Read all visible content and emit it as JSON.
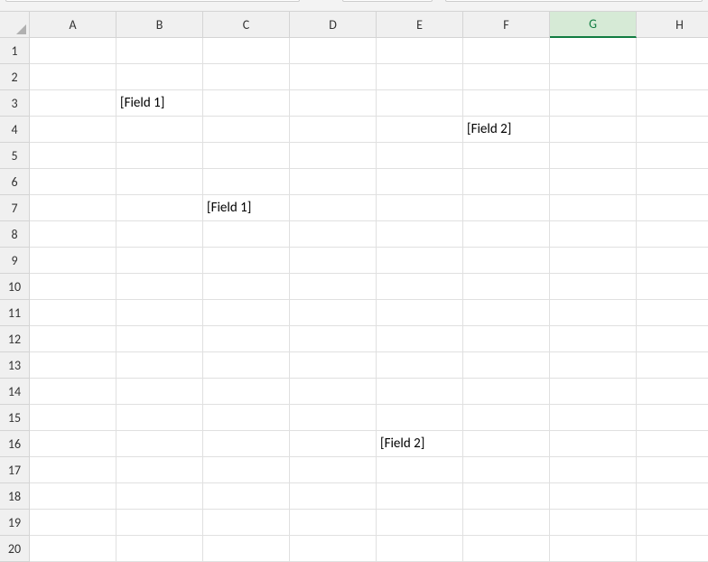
{
  "columns": [
    "A",
    "B",
    "C",
    "D",
    "E",
    "F",
    "G",
    "H"
  ],
  "active_column": "G",
  "row_count": 20,
  "cells": {
    "B3": "[Field 1]",
    "F4": "[Field 2]",
    "C7": "[Field 1]",
    "E16": "[Field 2]"
  }
}
